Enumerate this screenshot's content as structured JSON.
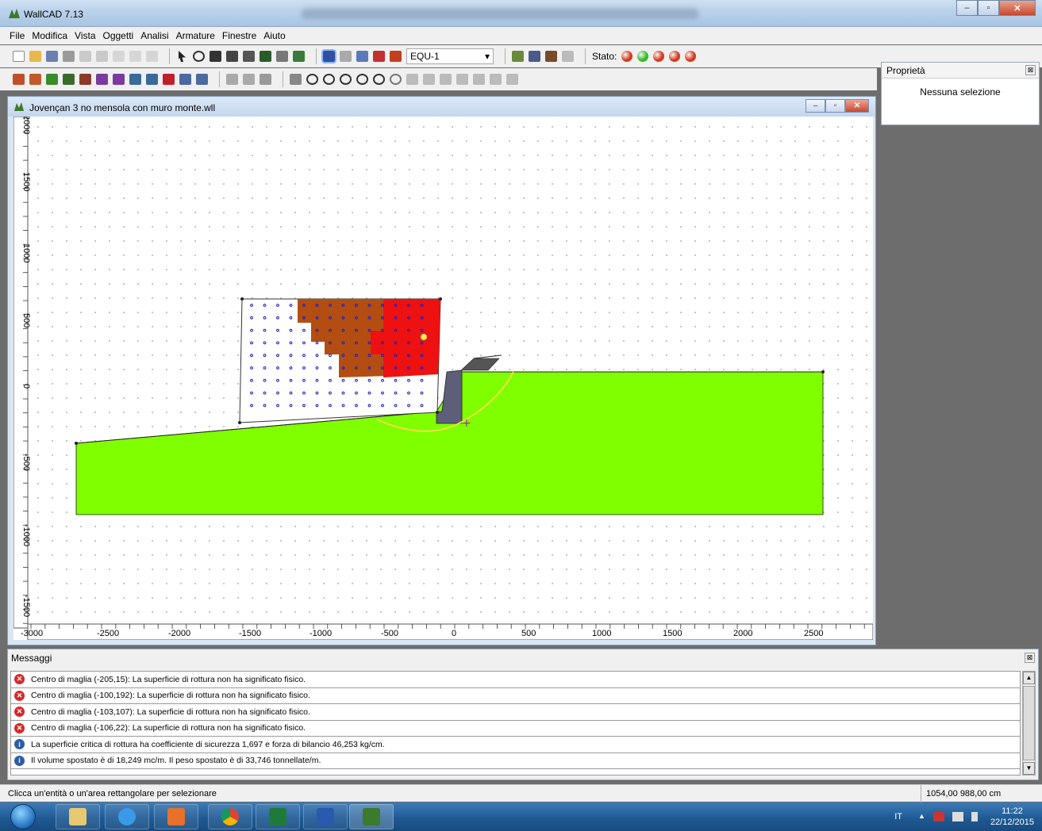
{
  "window": {
    "title": "WallCAD 7.13",
    "min_label": "–",
    "max_label": "▫",
    "close_label": "✕"
  },
  "menu": [
    "File",
    "Modifica",
    "Vista",
    "Oggetti",
    "Analisi",
    "Armature",
    "Finestre",
    "Aiuto"
  ],
  "toolbar": {
    "combination_value": "EQU-1",
    "combo_arrow": "▾",
    "stato_label": "Stato:"
  },
  "status_lights": [
    "#d23a1b",
    "#33bb22",
    "#d23a1b",
    "#d23a1b",
    "#d23a1b"
  ],
  "properties": {
    "title": "Proprietà",
    "close_label": "⊠",
    "empty_text": "Nessuna selezione"
  },
  "document": {
    "title": "Jovençan 3 no mensola con muro monte.wll",
    "min_label": "–",
    "max_label": "▫",
    "close_label": "✕"
  },
  "drawing": {
    "y_axis_labels": [
      "2000",
      "1500",
      "1000",
      "500",
      "0",
      "-500",
      "-1000",
      "-1500"
    ],
    "x_axis_labels": [
      "-3000",
      "-2500",
      "-2000",
      "-1500",
      "-1000",
      "-500",
      "0",
      "500",
      "1000",
      "1500",
      "2000",
      "2500"
    ],
    "colors": {
      "soil": "#7fff00",
      "wall": "#5d5f79",
      "grid_nodes": "#1e1ebd",
      "slip_surface": "#f0e040",
      "safety_high": "#ee1111",
      "safety_mid": "#b34d12",
      "critical_center": "#ffee33"
    }
  },
  "messages": {
    "title": "Messaggi",
    "close_label": "⊠",
    "items": [
      {
        "type": "error",
        "text": "Centro di maglia (-205,15): La superficie di rottura non ha significato fisico."
      },
      {
        "type": "error",
        "text": "Centro di maglia (-100,192): La superficie di rottura non ha significato fisico."
      },
      {
        "type": "error",
        "text": "Centro di maglia (-103,107): La superficie di rottura non ha significato fisico."
      },
      {
        "type": "error",
        "text": "Centro di maglia (-106,22): La superficie di rottura non ha significato fisico."
      },
      {
        "type": "info",
        "text": "La superficie critica di rottura ha coefficiente di sicurezza 1,697 e forza di bilancio 46,253 kg/cm."
      },
      {
        "type": "info",
        "text": "Il volume spostato è di 18,249 mc/m. Il peso spostato è di 33,746 tonnellate/m."
      }
    ],
    "scroll_up": "▲",
    "scroll_down": "▼"
  },
  "status_bar": {
    "hint": "Clicca un'entità o un'area rettangolare per selezionare",
    "coords": "1054,00 988,00 cm"
  },
  "taskbar": {
    "apps": [
      "file-explorer",
      "internet-explorer",
      "media-player",
      "chrome",
      "excel",
      "word",
      "wallcad"
    ],
    "lang": "IT",
    "tray_arrow": "▲",
    "time": "11:22",
    "date": "22/12/2015"
  }
}
